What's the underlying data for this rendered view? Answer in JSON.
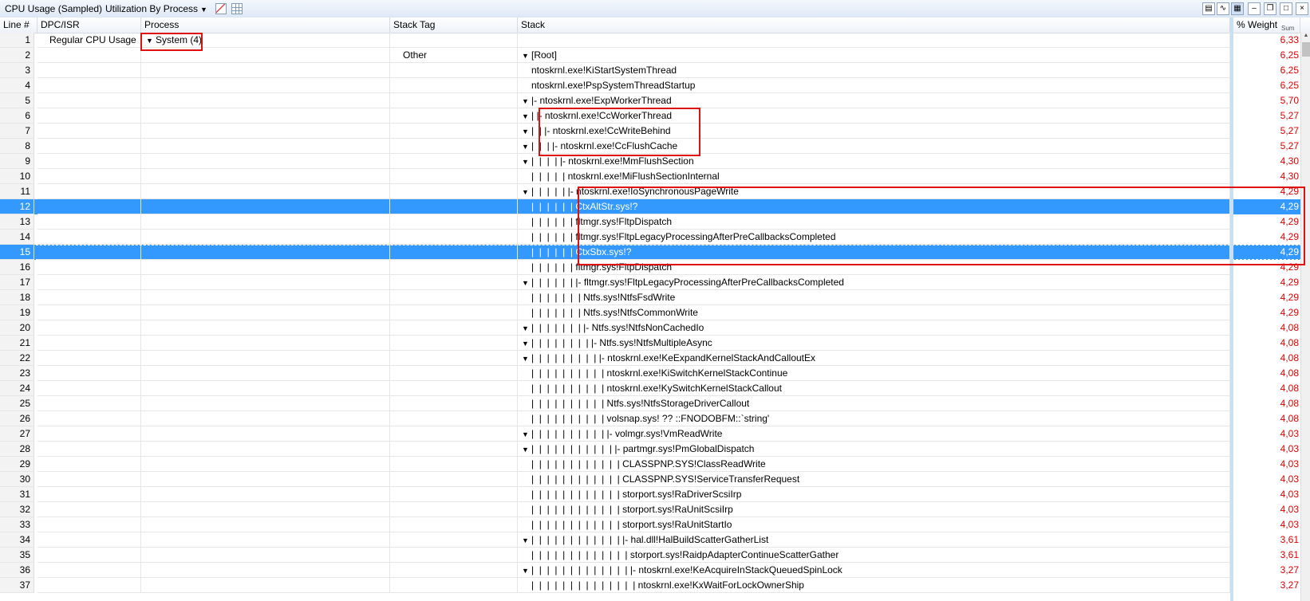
{
  "toolbar": {
    "title": "CPU Usage (Sampled)",
    "view": "Utilization By Process",
    "view_caret": "▼"
  },
  "columns": {
    "line": "Line #",
    "dpc": "DPC/ISR",
    "process": "Process",
    "tag": "Stack Tag",
    "stack": "Stack",
    "weight": "% Weight",
    "sum": "Sum"
  },
  "colors": {
    "selection": "#3399ff",
    "weight_text": "#e00000",
    "annotation": "#e01010"
  },
  "rows": [
    {
      "line": "1",
      "dpc": "Regular CPU Usage",
      "process": "System (4)",
      "tag": "",
      "pipes": "",
      "exp": false,
      "text": "",
      "weight": "6,33"
    },
    {
      "line": "2",
      "dpc": "",
      "process": "",
      "tag": "Other",
      "pipes": "",
      "exp": true,
      "text": "[Root]",
      "weight": "6,25"
    },
    {
      "line": "3",
      "dpc": "",
      "process": "",
      "tag": "",
      "pipes": "",
      "exp": false,
      "text": "ntoskrnl.exe!KiStartSystemThread",
      "weight": "6,25"
    },
    {
      "line": "4",
      "dpc": "",
      "process": "",
      "tag": "",
      "pipes": "",
      "exp": false,
      "text": "ntoskrnl.exe!PspSystemThreadStartup",
      "weight": "6,25"
    },
    {
      "line": "5",
      "dpc": "",
      "process": "",
      "tag": "",
      "pipes": "",
      "exp": true,
      "text": "|- ntoskrnl.exe!ExpWorkerThread",
      "weight": "5,70"
    },
    {
      "line": "6",
      "dpc": "",
      "process": "",
      "tag": "",
      "pipes": "| ",
      "exp": true,
      "text": "|- ntoskrnl.exe!CcWorkerThread",
      "weight": "5,27"
    },
    {
      "line": "7",
      "dpc": "",
      "process": "",
      "tag": "",
      "pipes": "|  | ",
      "exp": true,
      "text": "|- ntoskrnl.exe!CcWriteBehind",
      "weight": "5,27"
    },
    {
      "line": "8",
      "dpc": "",
      "process": "",
      "tag": "",
      "pipes": "|  |  | ",
      "exp": true,
      "text": "|- ntoskrnl.exe!CcFlushCache",
      "weight": "5,27"
    },
    {
      "line": "9",
      "dpc": "",
      "process": "",
      "tag": "",
      "pipes": "|  |  |  | ",
      "exp": true,
      "text": "|- ntoskrnl.exe!MmFlushSection",
      "weight": "4,30"
    },
    {
      "line": "10",
      "dpc": "",
      "process": "",
      "tag": "",
      "pipes": "|  |  |  |  | ",
      "exp": false,
      "text": "ntoskrnl.exe!MiFlushSectionInternal",
      "weight": "4,30"
    },
    {
      "line": "11",
      "dpc": "",
      "process": "",
      "tag": "",
      "pipes": "|  |  |  |  | ",
      "exp": true,
      "text": "|- ntoskrnl.exe!IoSynchronousPageWrite",
      "weight": "4,29"
    },
    {
      "line": "12",
      "dpc": "",
      "process": "",
      "tag": "",
      "pipes": "|  |  |  |  |  | ",
      "exp": false,
      "text": "CtxAltStr.sys!?",
      "weight": "4,29",
      "sel": true
    },
    {
      "line": "13",
      "dpc": "",
      "process": "",
      "tag": "",
      "pipes": "|  |  |  |  |  | ",
      "exp": false,
      "text": "fltmgr.sys!FltpDispatch",
      "weight": "4,29"
    },
    {
      "line": "14",
      "dpc": "",
      "process": "",
      "tag": "",
      "pipes": "|  |  |  |  |  | ",
      "exp": false,
      "text": "fltmgr.sys!FltpLegacyProcessingAfterPreCallbacksCompleted",
      "weight": "4,29"
    },
    {
      "line": "15",
      "dpc": "",
      "process": "",
      "tag": "",
      "pipes": "|  |  |  |  |  | ",
      "exp": false,
      "text": "CtxSbx.sys!?",
      "weight": "4,29",
      "sel": true,
      "focus": true
    },
    {
      "line": "16",
      "dpc": "",
      "process": "",
      "tag": "",
      "pipes": "|  |  |  |  |  | ",
      "exp": false,
      "text": "fltmgr.sys!FltpDispatch",
      "weight": "4,29"
    },
    {
      "line": "17",
      "dpc": "",
      "process": "",
      "tag": "",
      "pipes": "|  |  |  |  |  | ",
      "exp": true,
      "text": "|- fltmgr.sys!FltpLegacyProcessingAfterPreCallbacksCompleted",
      "weight": "4,29"
    },
    {
      "line": "18",
      "dpc": "",
      "process": "",
      "tag": "",
      "pipes": "|  |  |  |  |  |  | ",
      "exp": false,
      "text": "Ntfs.sys!NtfsFsdWrite",
      "weight": "4,29"
    },
    {
      "line": "19",
      "dpc": "",
      "process": "",
      "tag": "",
      "pipes": "|  |  |  |  |  |  | ",
      "exp": false,
      "text": "Ntfs.sys!NtfsCommonWrite",
      "weight": "4,29"
    },
    {
      "line": "20",
      "dpc": "",
      "process": "",
      "tag": "",
      "pipes": "|  |  |  |  |  |  | ",
      "exp": true,
      "text": "|- Ntfs.sys!NtfsNonCachedIo",
      "weight": "4,08"
    },
    {
      "line": "21",
      "dpc": "",
      "process": "",
      "tag": "",
      "pipes": "|  |  |  |  |  |  |  | ",
      "exp": true,
      "text": "|- Ntfs.sys!NtfsMultipleAsync",
      "weight": "4,08"
    },
    {
      "line": "22",
      "dpc": "",
      "process": "",
      "tag": "",
      "pipes": "|  |  |  |  |  |  |  |  | ",
      "exp": true,
      "text": "|- ntoskrnl.exe!KeExpandKernelStackAndCalloutEx",
      "weight": "4,08"
    },
    {
      "line": "23",
      "dpc": "",
      "process": "",
      "tag": "",
      "pipes": "|  |  |  |  |  |  |  |  |  | ",
      "exp": false,
      "text": "ntoskrnl.exe!KiSwitchKernelStackContinue",
      "weight": "4,08"
    },
    {
      "line": "24",
      "dpc": "",
      "process": "",
      "tag": "",
      "pipes": "|  |  |  |  |  |  |  |  |  | ",
      "exp": false,
      "text": "ntoskrnl.exe!KySwitchKernelStackCallout",
      "weight": "4,08"
    },
    {
      "line": "25",
      "dpc": "",
      "process": "",
      "tag": "",
      "pipes": "|  |  |  |  |  |  |  |  |  | ",
      "exp": false,
      "text": "Ntfs.sys!NtfsStorageDriverCallout",
      "weight": "4,08"
    },
    {
      "line": "26",
      "dpc": "",
      "process": "",
      "tag": "",
      "pipes": "|  |  |  |  |  |  |  |  |  | ",
      "exp": false,
      "text": "volsnap.sys! ?? ::FNODOBFM::`string'",
      "weight": "4,08"
    },
    {
      "line": "27",
      "dpc": "",
      "process": "",
      "tag": "",
      "pipes": "|  |  |  |  |  |  |  |  |  | ",
      "exp": true,
      "text": "|- volmgr.sys!VmReadWrite",
      "weight": "4,03"
    },
    {
      "line": "28",
      "dpc": "",
      "process": "",
      "tag": "",
      "pipes": "|  |  |  |  |  |  |  |  |  |  | ",
      "exp": true,
      "text": "|- partmgr.sys!PmGlobalDispatch",
      "weight": "4,03"
    },
    {
      "line": "29",
      "dpc": "",
      "process": "",
      "tag": "",
      "pipes": "|  |  |  |  |  |  |  |  |  |  |  | ",
      "exp": false,
      "text": "CLASSPNP.SYS!ClassReadWrite",
      "weight": "4,03"
    },
    {
      "line": "30",
      "dpc": "",
      "process": "",
      "tag": "",
      "pipes": "|  |  |  |  |  |  |  |  |  |  |  | ",
      "exp": false,
      "text": "CLASSPNP.SYS!ServiceTransferRequest",
      "weight": "4,03"
    },
    {
      "line": "31",
      "dpc": "",
      "process": "",
      "tag": "",
      "pipes": "|  |  |  |  |  |  |  |  |  |  |  | ",
      "exp": false,
      "text": "storport.sys!RaDriverScsiIrp",
      "weight": "4,03"
    },
    {
      "line": "32",
      "dpc": "",
      "process": "",
      "tag": "",
      "pipes": "|  |  |  |  |  |  |  |  |  |  |  | ",
      "exp": false,
      "text": "storport.sys!RaUnitScsiIrp",
      "weight": "4,03"
    },
    {
      "line": "33",
      "dpc": "",
      "process": "",
      "tag": "",
      "pipes": "|  |  |  |  |  |  |  |  |  |  |  | ",
      "exp": false,
      "text": "storport.sys!RaUnitStartIo",
      "weight": "4,03"
    },
    {
      "line": "34",
      "dpc": "",
      "process": "",
      "tag": "",
      "pipes": "|  |  |  |  |  |  |  |  |  |  |  | ",
      "exp": true,
      "text": "|- hal.dll!HalBuildScatterGatherList",
      "weight": "3,61"
    },
    {
      "line": "35",
      "dpc": "",
      "process": "",
      "tag": "",
      "pipes": "|  |  |  |  |  |  |  |  |  |  |  |  | ",
      "exp": false,
      "text": "storport.sys!RaidpAdapterContinueScatterGather",
      "weight": "3,61"
    },
    {
      "line": "36",
      "dpc": "",
      "process": "",
      "tag": "",
      "pipes": "|  |  |  |  |  |  |  |  |  |  |  |  | ",
      "exp": true,
      "text": "|- ntoskrnl.exe!KeAcquireInStackQueuedSpinLock",
      "weight": "3,27"
    },
    {
      "line": "37",
      "dpc": "",
      "process": "",
      "tag": "",
      "pipes": "|  |  |  |  |  |  |  |  |  |  |  |  |  | ",
      "exp": false,
      "text": "ntoskrnl.exe!KxWaitForLockOwnerShip",
      "weight": "3,27"
    }
  ]
}
